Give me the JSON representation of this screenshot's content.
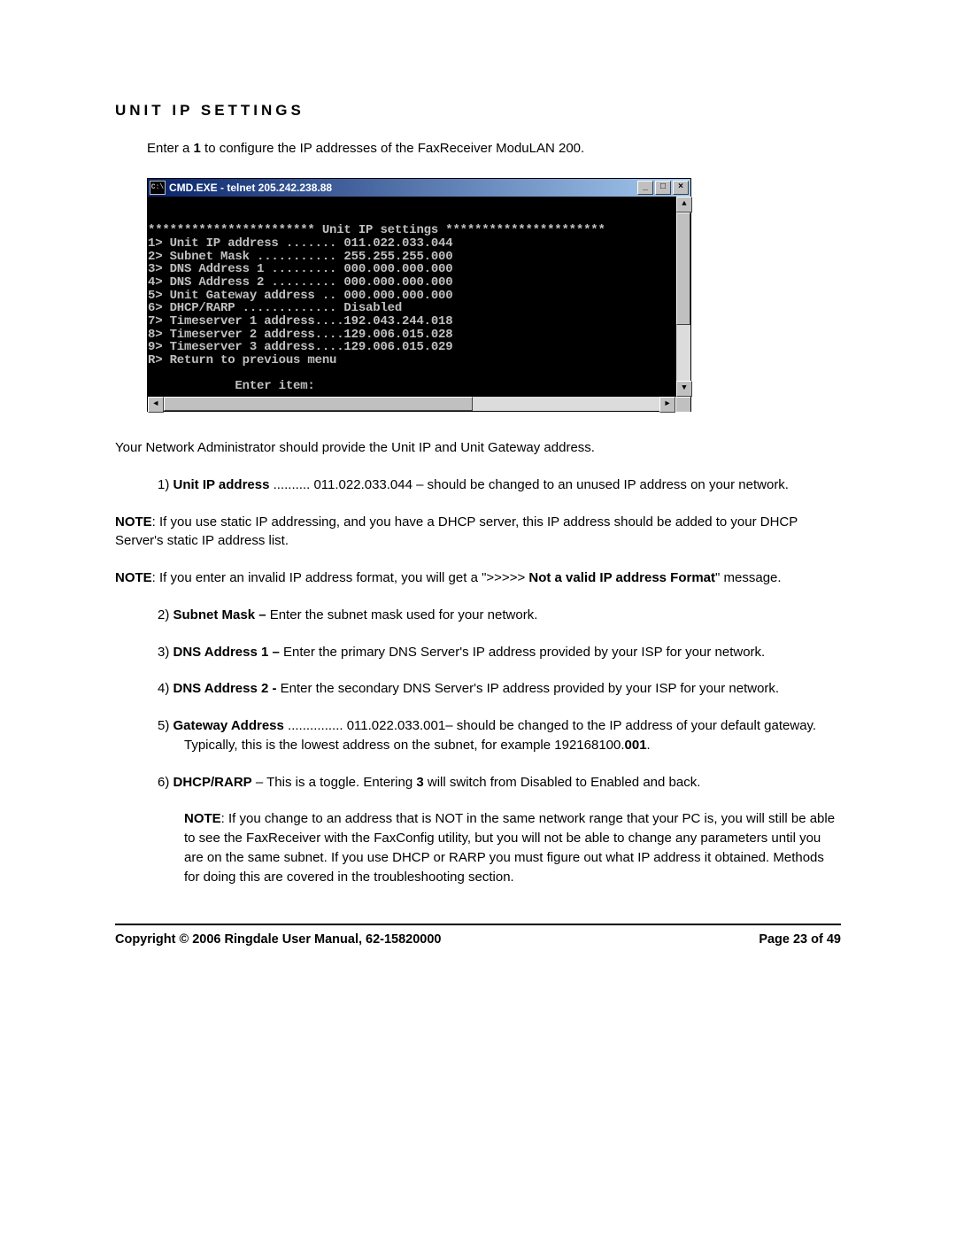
{
  "heading": "UNIT IP SETTINGS",
  "intro": {
    "prefix": "Enter a ",
    "bold": "1",
    "suffix": " to configure the IP addresses of the FaxReceiver ModuLAN 200."
  },
  "cmd": {
    "icon_text": "C:\\",
    "title": "CMD.EXE - telnet 205.242.238.88",
    "min_glyph": "_",
    "max_glyph": "□",
    "close_glyph": "×",
    "up_glyph": "▲",
    "down_glyph": "▼",
    "left_glyph": "◄",
    "right_glyph": "►",
    "lines": [
      "",
      "",
      "*********************** Unit IP settings **********************",
      "1> Unit IP address ....... 011.022.033.044",
      "2> Subnet Mask ........... 255.255.255.000",
      "3> DNS Address 1 ......... 000.000.000.000",
      "4> DNS Address 2 ......... 000.000.000.000",
      "5> Unit Gateway address .. 000.000.000.000",
      "6> DHCP/RARP ............. Disabled",
      "7> Timeserver 1 address....192.043.244.018",
      "8> Timeserver 2 address....129.006.015.028",
      "9> Timeserver 3 address....129.006.015.029",
      "R> Return to previous menu",
      "",
      "            Enter item:"
    ]
  },
  "admin_note": "Your Network Administrator should provide the Unit IP and Unit Gateway address.",
  "item1": {
    "num": "1) ",
    "bold": "Unit IP address",
    "rest": " .......... 011.022.033.044 – should be changed to an unused IP address on your network."
  },
  "note1": {
    "label": "NOTE",
    "text": ":  If you use static IP addressing, and you have a DHCP server, this IP address should be added to your DHCP Server's static IP address list."
  },
  "note2": {
    "label": "NOTE",
    "mid": ":  If you enter an invalid IP address format, you will get a \">>>>> ",
    "bold2": "Not a valid IP address Format",
    "end": "\" message."
  },
  "item2": {
    "num": "2) ",
    "bold": "Subnet Mask –",
    "rest": " Enter the subnet mask used for your network."
  },
  "item3": {
    "num": "3) ",
    "bold": "DNS Address 1 –",
    "rest": " Enter the primary DNS Server's IP address provided by your ISP for your network."
  },
  "item4": {
    "num": "4) ",
    "bold": "DNS Address 2 -",
    "rest": " Enter the secondary DNS Server's IP address provided by your ISP for your network."
  },
  "item5": {
    "num": "5) ",
    "bold": "Gateway Address",
    "mid": " ............... 011.022.033.001– should be changed to the IP address of your default gateway. Typically, this is the lowest address on the subnet, for example 192168100.",
    "bold2": "001",
    "end": "."
  },
  "item6": {
    "num": "6) ",
    "bold": "DHCP/RARP",
    "mid": " – This is a toggle. Entering ",
    "bold2": "3",
    "end": " will switch from Disabled to Enabled and back."
  },
  "subnote": {
    "label": "NOTE",
    "text": ": If you change to an address that is NOT in the same network range that your PC is, you will still be able to see the FaxReceiver with the FaxConfig utility, but you will not be able to change any parameters until you are on the same subnet. If you use DHCP or RARP you must figure out what IP address it obtained. Methods for doing this are covered in the troubleshooting section."
  },
  "footer": {
    "left": "Copyright © 2006 Ringdale   User Manual, 62-15820000",
    "right": "Page 23 of 49"
  }
}
